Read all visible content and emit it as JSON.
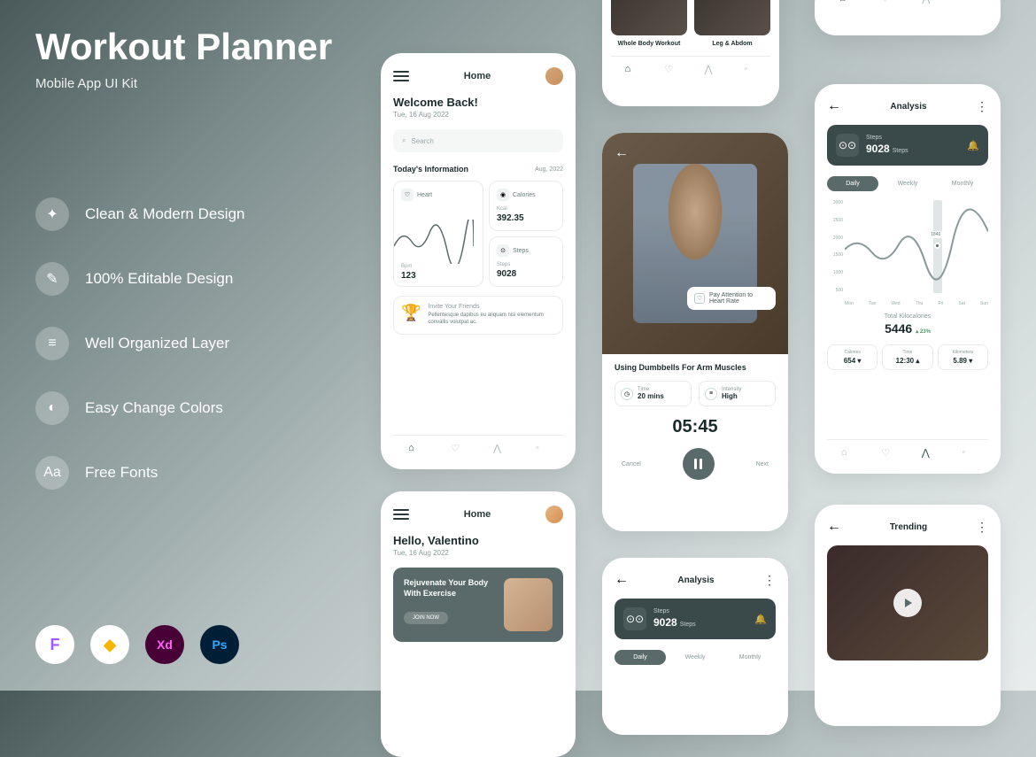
{
  "heading": {
    "title": "Workout Planner",
    "subtitle": "Mobile App UI Kit"
  },
  "features": [
    "Clean & Modern Design",
    "100% Editable Design",
    "Well Organized Layer",
    "Easy Change Colors",
    "Free Fonts"
  ],
  "tools": [
    "F",
    "◆",
    "Xd",
    "Ps"
  ],
  "home": {
    "title": "Home",
    "welcome": "Welcome Back!",
    "date": "Tue, 16 Aug 2022",
    "search": "Search",
    "info_title": "Today's Information",
    "info_date": "Aug, 2022",
    "heart": {
      "label": "Heart",
      "unit": "Bpm",
      "value": "123"
    },
    "calories": {
      "label": "Calories",
      "unit": "Kcal",
      "value": "392.35"
    },
    "steps": {
      "label": "Steps",
      "unit": "Steps",
      "value": "9028"
    },
    "invite": {
      "title": "Invite Your Friends",
      "desc": "Pellentesque dapibus eu aliquam nisi elementum convallis volutpat ac."
    }
  },
  "workout": {
    "labels": [
      "Whole Body Workout",
      "Leg & Abdom"
    ]
  },
  "detail": {
    "tip": "Pay Attention to Heart Rate",
    "title": "Using Dumbbells For Arm Muscles",
    "time": {
      "label": "Time",
      "value": "20 mins"
    },
    "intensity": {
      "label": "Intensity",
      "value": "High"
    },
    "timer": "05:45",
    "cancel": "Cancel",
    "next": "Next"
  },
  "analysis": {
    "title": "Analysis",
    "steps_label": "Steps",
    "steps_value": "9028",
    "steps_unit": "Steps",
    "tabs": [
      "Daily",
      "Weekly",
      "Monthly"
    ],
    "y": [
      "3000",
      "2500",
      "2000",
      "1500",
      "1000",
      "500"
    ],
    "x": [
      "Mon",
      "Tue",
      "Wed",
      "Thu",
      "Fri",
      "Sat",
      "Sun"
    ],
    "highlight": "1846",
    "kcal_title": "Total Kilocalories",
    "kcal_value": "5446",
    "kcal_pct": "23%",
    "metrics": [
      {
        "label": "Calories",
        "value": "654 ▾"
      },
      {
        "label": "Time",
        "value": "12:30 ▴"
      },
      {
        "label": "Kilometers",
        "value": "5.89 ▾"
      }
    ]
  },
  "home2": {
    "title": "Home",
    "greeting": "Hello, Valentino",
    "date": "Tue, 16 Aug 2022",
    "hero_title": "Rejuvenate Your Body With Exercise",
    "hero_btn": "JOIN NOW"
  },
  "trending": {
    "title": "Trending"
  }
}
